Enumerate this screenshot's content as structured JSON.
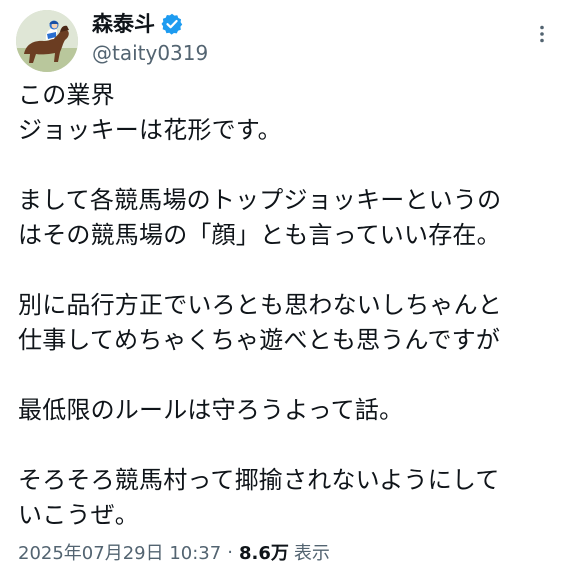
{
  "author": {
    "display_name": "森泰斗",
    "handle": "@taity0319",
    "verified": true,
    "verified_color": "#1d9bf0"
  },
  "tweet": {
    "lines": [
      "この業界",
      "ジョッキーは花形です。",
      "",
      "まして各競馬場のトップジョッキーというの",
      "はその競馬場の「顔」とも言っていい存在。",
      "",
      "別に品行方正でいろとも思わないしちゃんと",
      "仕事してめちゃくちゃ遊べとも思うんですが",
      "",
      "最低限のルールは守ろうよって話。",
      "",
      "そろそろ競馬村って揶揄されないようにして",
      "いこうぜ。"
    ]
  },
  "meta": {
    "timestamp": "2025年07月29日 10:37",
    "separator": "·",
    "views_count": "8.6万",
    "views_label": "表示"
  },
  "icons": {
    "avatar": "avatar-jockey-on-horse",
    "verified": "verified-badge-icon",
    "more": "more-options-icon"
  }
}
